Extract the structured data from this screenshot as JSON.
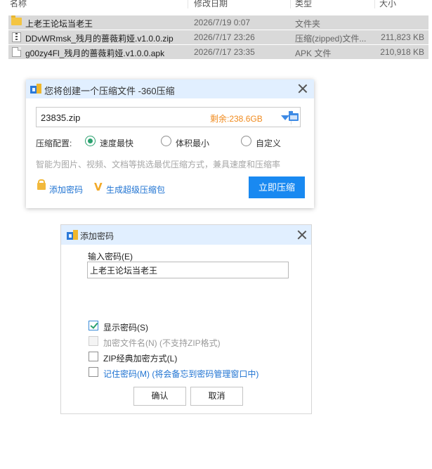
{
  "explorer": {
    "columns": {
      "name": "名称",
      "date": "修改日期",
      "type": "类型",
      "size": "大小"
    },
    "rows": [
      {
        "icon": "folder-icon",
        "name": "上老王论坛当老王",
        "date": "2026/7/19 0:07",
        "type": "文件夹",
        "size": ""
      },
      {
        "icon": "zip-file-icon",
        "name": "DDvWRmsk_残月的蔷薇莉娅.v1.0.0.zip",
        "date": "2026/7/17 23:26",
        "type": "压缩(zipped)文件...",
        "size": "211,823 KB"
      },
      {
        "icon": "apk-file-icon",
        "name": "g00zy4Fl_残月的蔷薇莉娅.v1.0.0.apk",
        "date": "2026/7/17 23:35",
        "type": "APK 文件",
        "size": "210,918 KB"
      }
    ]
  },
  "compress_dialog": {
    "title": "您将创建一个压缩文件 -360压缩",
    "filename": "23835.zip",
    "remaining": "剩余:238.6GB",
    "config_label": "压缩配置:",
    "options": [
      "速度最快",
      "体积最小",
      "自定义"
    ],
    "selected_option": "速度最快",
    "hint": "智能为图片、视频、文档等挑选最优压缩方式，兼具速度和压缩率",
    "add_password": "添加密码",
    "super_package": "生成超级压缩包",
    "compress_now": "立即压缩"
  },
  "password_dialog": {
    "title": "添加密码",
    "input_label": "输入密码(E)",
    "password_value": "上老王论坛当老王",
    "options": [
      {
        "label": "显示密码(S)",
        "checked": true,
        "disabled": false
      },
      {
        "label": "加密文件名(N) (不支持ZIP格式)",
        "checked": false,
        "disabled": true
      },
      {
        "label": "ZIP经典加密方式(L)",
        "checked": false,
        "disabled": false
      },
      {
        "label": "记住密码(M) (将会备忘到密码管理窗口中)",
        "checked": false,
        "disabled": false
      }
    ],
    "ok": "确认",
    "cancel": "取消"
  },
  "colors": {
    "title_bar": "#e1efff",
    "accent_blue": "#1989f1",
    "remain_orange": "#f08a1d",
    "radio_green": "#2aa06e",
    "row_selected": "#d9d9d9"
  }
}
